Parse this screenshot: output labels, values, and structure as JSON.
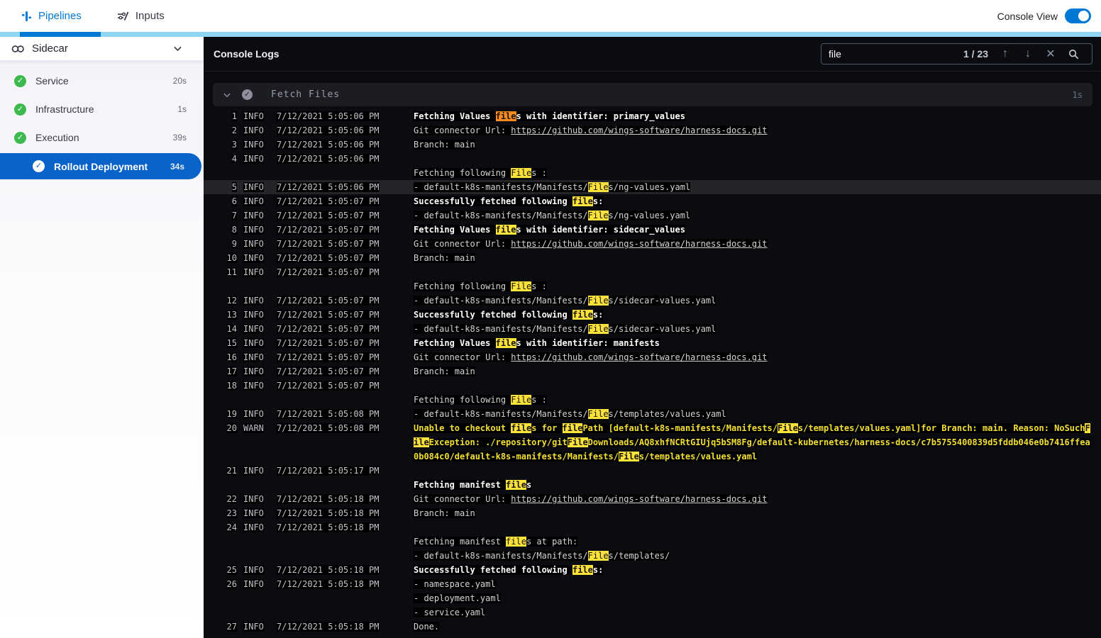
{
  "colors": {
    "accent_blue": "#0278d5",
    "accent_strip": "#8fd6f2",
    "selected_item": "#0a63c9",
    "success_green": "#3cba50",
    "console_bg": "#0b0c10",
    "warn_yellow": "#f3df35",
    "match_highlight": "#fde23b",
    "current_match_highlight": "#fc8b1f"
  },
  "topbar": {
    "tabs": [
      {
        "label": "Pipelines",
        "icon": "pipeline-icon",
        "active": true
      },
      {
        "label": "Inputs",
        "icon": "inputs-icon",
        "active": false
      }
    ],
    "console_view_label": "Console View",
    "console_view_on": true
  },
  "sidebar": {
    "title": "Sidecar",
    "items": [
      {
        "label": "Service",
        "duration": "20s",
        "status": "success",
        "selected": false,
        "indent": false
      },
      {
        "label": "Infrastructure",
        "duration": "1s",
        "status": "success",
        "selected": false,
        "indent": false
      },
      {
        "label": "Execution",
        "duration": "39s",
        "status": "success",
        "selected": false,
        "indent": false
      },
      {
        "label": "Rollout Deployment",
        "duration": "34s",
        "status": "success",
        "selected": true,
        "indent": true
      }
    ]
  },
  "console": {
    "title": "Console Logs",
    "search": {
      "value": "file",
      "count": "1 / 23"
    },
    "section": {
      "title": "Fetch Files",
      "duration": "1s"
    }
  },
  "log_entries": [
    {
      "n": 1,
      "lvl": "INFO",
      "t": "7/12/2021 5:05:06 PM",
      "hl": false,
      "lines": [
        {
          "b": true,
          "w": false,
          "segs": [
            [
              "Fetching Values ",
              ""
            ],
            [
              "file",
              "c"
            ],
            [
              "s with identifier: primary_values",
              ""
            ]
          ]
        }
      ]
    },
    {
      "n": 2,
      "lvl": "INFO",
      "t": "7/12/2021 5:05:06 PM",
      "hl": false,
      "lines": [
        {
          "b": false,
          "w": false,
          "segs": [
            [
              "Git connector Url: ",
              ""
            ],
            [
              "https://github.com/wings-software/harness-docs.git",
              "u"
            ]
          ]
        }
      ]
    },
    {
      "n": 3,
      "lvl": "INFO",
      "t": "7/12/2021 5:05:06 PM",
      "hl": false,
      "lines": [
        {
          "b": false,
          "w": false,
          "segs": [
            [
              "Branch: main",
              ""
            ]
          ]
        }
      ]
    },
    {
      "n": 4,
      "lvl": "INFO",
      "t": "7/12/2021 5:05:06 PM",
      "hl": false,
      "lines": [
        {
          "b": false,
          "w": false,
          "segs": []
        },
        {
          "b": false,
          "w": false,
          "segs": [
            [
              "Fetching following ",
              ""
            ],
            [
              "File",
              "y"
            ],
            [
              "s :",
              ""
            ]
          ]
        }
      ]
    },
    {
      "n": 5,
      "lvl": "INFO",
      "t": "7/12/2021 5:05:06 PM",
      "hl": true,
      "lines": [
        {
          "b": false,
          "w": false,
          "segs": [
            [
              "- default-k8s-manifests/Manifests/",
              ""
            ],
            [
              "File",
              "y"
            ],
            [
              "s/ng-values.yaml",
              ""
            ]
          ]
        }
      ]
    },
    {
      "n": 6,
      "lvl": "INFO",
      "t": "7/12/2021 5:05:07 PM",
      "hl": false,
      "lines": [
        {
          "b": true,
          "w": false,
          "segs": [
            [
              "Successfully fetched following ",
              ""
            ],
            [
              "file",
              "y"
            ],
            [
              "s:",
              ""
            ]
          ]
        }
      ]
    },
    {
      "n": 7,
      "lvl": "INFO",
      "t": "7/12/2021 5:05:07 PM",
      "hl": false,
      "lines": [
        {
          "b": false,
          "w": false,
          "segs": [
            [
              "- default-k8s-manifests/Manifests/",
              ""
            ],
            [
              "File",
              "y"
            ],
            [
              "s/ng-values.yaml",
              ""
            ]
          ]
        }
      ]
    },
    {
      "n": 8,
      "lvl": "INFO",
      "t": "7/12/2021 5:05:07 PM",
      "hl": false,
      "lines": [
        {
          "b": true,
          "w": false,
          "segs": [
            [
              "Fetching Values ",
              ""
            ],
            [
              "file",
              "y"
            ],
            [
              "s with identifier: sidecar_values",
              ""
            ]
          ]
        }
      ]
    },
    {
      "n": 9,
      "lvl": "INFO",
      "t": "7/12/2021 5:05:07 PM",
      "hl": false,
      "lines": [
        {
          "b": false,
          "w": false,
          "segs": [
            [
              "Git connector Url: ",
              ""
            ],
            [
              "https://github.com/wings-software/harness-docs.git",
              "u"
            ]
          ]
        }
      ]
    },
    {
      "n": 10,
      "lvl": "INFO",
      "t": "7/12/2021 5:05:07 PM",
      "hl": false,
      "lines": [
        {
          "b": false,
          "w": false,
          "segs": [
            [
              "Branch: main",
              ""
            ]
          ]
        }
      ]
    },
    {
      "n": 11,
      "lvl": "INFO",
      "t": "7/12/2021 5:05:07 PM",
      "hl": false,
      "lines": [
        {
          "b": false,
          "w": false,
          "segs": []
        },
        {
          "b": false,
          "w": false,
          "segs": [
            [
              "Fetching following ",
              ""
            ],
            [
              "File",
              "y"
            ],
            [
              "s :",
              ""
            ]
          ]
        }
      ]
    },
    {
      "n": 12,
      "lvl": "INFO",
      "t": "7/12/2021 5:05:07 PM",
      "hl": false,
      "lines": [
        {
          "b": false,
          "w": false,
          "segs": [
            [
              "- default-k8s-manifests/Manifests/",
              ""
            ],
            [
              "File",
              "y"
            ],
            [
              "s/sidecar-values.yaml",
              ""
            ]
          ]
        }
      ]
    },
    {
      "n": 13,
      "lvl": "INFO",
      "t": "7/12/2021 5:05:07 PM",
      "hl": false,
      "lines": [
        {
          "b": true,
          "w": false,
          "segs": [
            [
              "Successfully fetched following ",
              ""
            ],
            [
              "file",
              "y"
            ],
            [
              "s:",
              ""
            ]
          ]
        }
      ]
    },
    {
      "n": 14,
      "lvl": "INFO",
      "t": "7/12/2021 5:05:07 PM",
      "hl": false,
      "lines": [
        {
          "b": false,
          "w": false,
          "segs": [
            [
              "- default-k8s-manifests/Manifests/",
              ""
            ],
            [
              "File",
              "y"
            ],
            [
              "s/sidecar-values.yaml",
              ""
            ]
          ]
        }
      ]
    },
    {
      "n": 15,
      "lvl": "INFO",
      "t": "7/12/2021 5:05:07 PM",
      "hl": false,
      "lines": [
        {
          "b": true,
          "w": false,
          "segs": [
            [
              "Fetching Values ",
              ""
            ],
            [
              "file",
              "y"
            ],
            [
              "s with identifier: manifests",
              ""
            ]
          ]
        }
      ]
    },
    {
      "n": 16,
      "lvl": "INFO",
      "t": "7/12/2021 5:05:07 PM",
      "hl": false,
      "lines": [
        {
          "b": false,
          "w": false,
          "segs": [
            [
              "Git connector Url: ",
              ""
            ],
            [
              "https://github.com/wings-software/harness-docs.git",
              "u"
            ]
          ]
        }
      ]
    },
    {
      "n": 17,
      "lvl": "INFO",
      "t": "7/12/2021 5:05:07 PM",
      "hl": false,
      "lines": [
        {
          "b": false,
          "w": false,
          "segs": [
            [
              "Branch: main",
              ""
            ]
          ]
        }
      ]
    },
    {
      "n": 18,
      "lvl": "INFO",
      "t": "7/12/2021 5:05:07 PM",
      "hl": false,
      "lines": [
        {
          "b": false,
          "w": false,
          "segs": []
        },
        {
          "b": false,
          "w": false,
          "segs": [
            [
              "Fetching following ",
              ""
            ],
            [
              "File",
              "y"
            ],
            [
              "s :",
              ""
            ]
          ]
        }
      ]
    },
    {
      "n": 19,
      "lvl": "INFO",
      "t": "7/12/2021 5:05:08 PM",
      "hl": false,
      "lines": [
        {
          "b": false,
          "w": false,
          "segs": [
            [
              "- default-k8s-manifests/Manifests/",
              ""
            ],
            [
              "File",
              "y"
            ],
            [
              "s/templates/values.yaml",
              ""
            ]
          ]
        }
      ]
    },
    {
      "n": 20,
      "lvl": "WARN",
      "t": "7/12/2021 5:05:08 PM",
      "hl": false,
      "lines": [
        {
          "b": false,
          "w": true,
          "segs": [
            [
              "Unable to checkout ",
              ""
            ],
            [
              "file",
              "y"
            ],
            [
              "s for ",
              ""
            ],
            [
              "file",
              "y"
            ],
            [
              "Path [default-k8s-manifests/Manifests/",
              ""
            ],
            [
              "File",
              "y"
            ],
            [
              "s/templates/values.yaml]for Branch: main. Reason: NoSuch",
              ""
            ],
            [
              "F",
              "y"
            ]
          ]
        },
        {
          "b": false,
          "w": true,
          "segs": [
            [
              "ile",
              "y"
            ],
            [
              "Exception: ./repository/git",
              ""
            ],
            [
              "File",
              "y"
            ],
            [
              "Downloads/AQ8xhfNCRtGIUjq5bSM8Fg/default-kubernetes/harness-docs/c7b5755400839d5fddb046e0b7416ffea",
              ""
            ]
          ]
        },
        {
          "b": false,
          "w": true,
          "segs": [
            [
              "0b084c0/default-k8s-manifests/Manifests/",
              ""
            ],
            [
              "File",
              "y"
            ],
            [
              "s/templates/values.yaml",
              ""
            ]
          ]
        }
      ]
    },
    {
      "n": 21,
      "lvl": "INFO",
      "t": "7/12/2021 5:05:17 PM",
      "hl": false,
      "lines": [
        {
          "b": false,
          "w": false,
          "segs": []
        },
        {
          "b": true,
          "w": false,
          "segs": [
            [
              "Fetching manifest ",
              ""
            ],
            [
              "file",
              "y"
            ],
            [
              "s",
              ""
            ]
          ]
        }
      ]
    },
    {
      "n": 22,
      "lvl": "INFO",
      "t": "7/12/2021 5:05:18 PM",
      "hl": false,
      "lines": [
        {
          "b": false,
          "w": false,
          "segs": [
            [
              "Git connector Url: ",
              ""
            ],
            [
              "https://github.com/wings-software/harness-docs.git",
              "u"
            ]
          ]
        }
      ]
    },
    {
      "n": 23,
      "lvl": "INFO",
      "t": "7/12/2021 5:05:18 PM",
      "hl": false,
      "lines": [
        {
          "b": false,
          "w": false,
          "segs": [
            [
              "Branch: main",
              ""
            ]
          ]
        }
      ]
    },
    {
      "n": 24,
      "lvl": "INFO",
      "t": "7/12/2021 5:05:18 PM",
      "hl": false,
      "lines": [
        {
          "b": false,
          "w": false,
          "segs": []
        },
        {
          "b": false,
          "w": false,
          "segs": [
            [
              "Fetching manifest ",
              ""
            ],
            [
              "file",
              "y"
            ],
            [
              "s at path:",
              ""
            ]
          ]
        },
        {
          "b": false,
          "w": false,
          "segs": [
            [
              "- default-k8s-manifests/Manifests/",
              ""
            ],
            [
              "File",
              "y"
            ],
            [
              "s/templates/",
              ""
            ]
          ]
        }
      ]
    },
    {
      "n": 25,
      "lvl": "INFO",
      "t": "7/12/2021 5:05:18 PM",
      "hl": false,
      "lines": [
        {
          "b": true,
          "w": false,
          "segs": [
            [
              "Successfully fetched following ",
              ""
            ],
            [
              "file",
              "y"
            ],
            [
              "s:",
              ""
            ]
          ]
        }
      ]
    },
    {
      "n": 26,
      "lvl": "INFO",
      "t": "7/12/2021 5:05:18 PM",
      "hl": false,
      "lines": [
        {
          "b": false,
          "w": false,
          "segs": [
            [
              "- namespace.yaml",
              ""
            ]
          ]
        },
        {
          "b": false,
          "w": false,
          "segs": [
            [
              "- deployment.yaml",
              ""
            ]
          ]
        },
        {
          "b": false,
          "w": false,
          "segs": [
            [
              "- service.yaml",
              ""
            ]
          ]
        }
      ]
    },
    {
      "n": 27,
      "lvl": "INFO",
      "t": "7/12/2021 5:05:18 PM",
      "hl": false,
      "lines": [
        {
          "b": false,
          "w": false,
          "segs": [
            [
              "Done.",
              ""
            ]
          ]
        }
      ]
    }
  ]
}
